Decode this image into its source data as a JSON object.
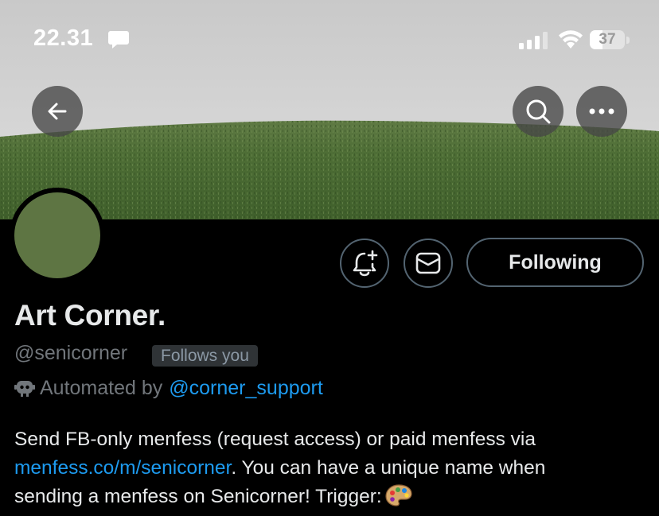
{
  "status_bar": {
    "time": "22.31",
    "battery_level": "37",
    "battery_fraction": 0.37
  },
  "nav": {
    "back_icon": "arrow-left-icon",
    "search_icon": "search-icon",
    "more_icon": "more-horizontal-icon"
  },
  "profile": {
    "display_name": "Art Corner.",
    "handle": "@senicorner",
    "follows_you": "Follows you",
    "automated_by_label": "Automated by",
    "automated_by_handle": "@corner_support",
    "avatar_color": "#5e7543"
  },
  "actions": {
    "notify_icon": "bell-plus-icon",
    "message_icon": "envelope-icon",
    "following_label": "Following"
  },
  "bio": {
    "line1": "Send FB-only menfess (request access) or paid menfess via",
    "link": "menfess.co/m/senicorner",
    "line2_rest": ". You can have a unique name when",
    "line3": "sending a menfess on Senicorner! Trigger:",
    "emoji_icon": "artist-palette-icon"
  },
  "colors": {
    "background": "#000000",
    "text": "#e7e9ea",
    "muted": "#71767b",
    "link": "#1d9bf0",
    "border": "#536471"
  }
}
